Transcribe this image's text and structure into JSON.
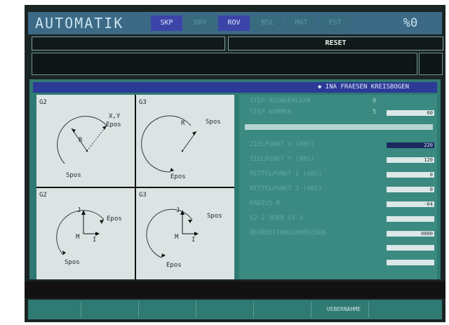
{
  "topbar": {
    "mode_title": "AUTOMATIK",
    "tabs": [
      {
        "label": "SKP",
        "active": true
      },
      {
        "label": "DRY",
        "active": false
      },
      {
        "label": "ROV",
        "active": true
      },
      {
        "label": "BSL",
        "active": false
      },
      {
        "label": "MAT",
        "active": false
      },
      {
        "label": "FST",
        "active": false
      }
    ],
    "percent": "%0"
  },
  "reset_label": "RESET",
  "panel": {
    "header": "◆ INA FRAESEN KREISBOGEN",
    "diagrams": [
      {
        "code": "G2",
        "labels": {
          "xy": "X,Y",
          "epos": "Epos",
          "spos": "Spos",
          "r": "R"
        }
      },
      {
        "code": "G3",
        "labels": {
          "epos": "Epos",
          "spos": "Spos",
          "r": "R"
        }
      },
      {
        "code": "G2",
        "labels": {
          "epos": "Epos",
          "spos": "Spos",
          "j": "J",
          "i": "I",
          "m": "M"
        }
      },
      {
        "code": "G3",
        "labels": {
          "epos": "Epos",
          "spos": "Spos",
          "j": "J",
          "i": "I",
          "m": "M"
        }
      }
    ],
    "params": [
      {
        "label": "STEP AUSWAEHLBAR",
        "value": "0",
        "box": null
      },
      {
        "label": "STEP NUMMER",
        "value": "5",
        "box": "60"
      },
      {
        "label": "ZIELPUNKT  X (ABS)",
        "value": "",
        "box": "220",
        "selected": true
      },
      {
        "label": "ZIELPUNKT  Y (ABS)",
        "value": "",
        "box": "120"
      },
      {
        "label": "MITTELPUNKT I (ABS)",
        "value": "",
        "box": "0"
      },
      {
        "label": "MITTELPUNKT J (ABS)",
        "value": "",
        "box": "0"
      },
      {
        "label": "RADIUS     R",
        "value": "",
        "box": "-64"
      },
      {
        "label": "G2-2  ODER  G3-3",
        "value": "",
        "box": ""
      },
      {
        "label": "BEARBEITUNGSVORSCHUB",
        "value": "",
        "box": "0000"
      }
    ]
  },
  "softkeys": [
    "",
    "",
    "",
    "",
    "",
    "UEBERNAHME",
    ""
  ],
  "colors": {
    "frame": "#1a2423",
    "topbar": "#3c6a86",
    "tab_active": "#3c44a8",
    "panel": "#2f7a72",
    "diagram_bg": "#dbe4e3",
    "header_strip": "#2b3a96"
  }
}
